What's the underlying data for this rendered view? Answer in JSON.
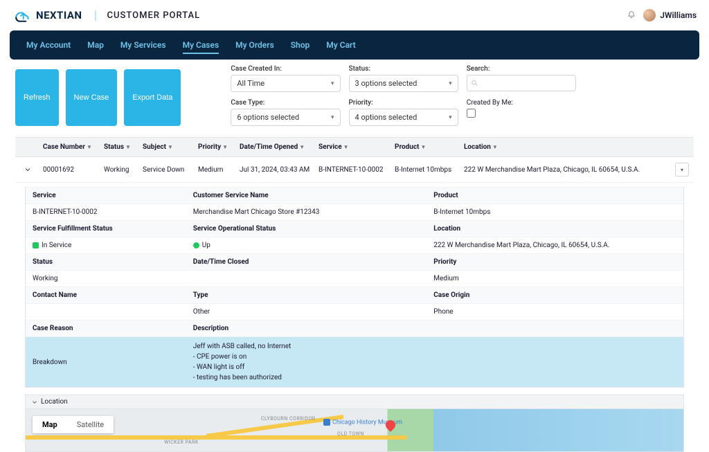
{
  "header": {
    "brand": "NEXTIAN",
    "portal": "CUSTOMER PORTAL",
    "username": "JWilliams"
  },
  "nav": {
    "items": [
      "My Account",
      "Map",
      "My Services",
      "My Cases",
      "My Orders",
      "Shop",
      "My Cart"
    ],
    "active_index": 3
  },
  "actions": {
    "refresh": "Refresh",
    "new_case": "New Case",
    "export_data": "Export Data"
  },
  "filters": {
    "created": {
      "label": "Case Created In:",
      "value": "All Time"
    },
    "status": {
      "label": "Status:",
      "value": "3 options selected"
    },
    "search": {
      "label": "Search:",
      "placeholder": ""
    },
    "type": {
      "label": "Case Type:",
      "value": "6 options selected"
    },
    "priority": {
      "label": "Priority:",
      "value": "4 options selected"
    },
    "created_by_me": {
      "label": "Created By Me:"
    }
  },
  "table": {
    "columns": [
      "Case Number",
      "Status",
      "Subject",
      "Priority",
      "Date/Time Opened",
      "Service",
      "Product",
      "Location"
    ],
    "row": {
      "case_number": "00001692",
      "status": "Working",
      "subject": "Service Down",
      "priority": "Medium",
      "opened": "Jul 31, 2024, 03:43 AM",
      "service": "B-INTERNET-10-0002",
      "product": "B-Internet 10mbps",
      "location": "222 W Merchandise Mart Plaza, Chicago, IL 60654, U.S.A."
    }
  },
  "detail": {
    "service_h": "Service",
    "csn_h": "Customer Service Name",
    "product_h": "Product",
    "service_v": "B-INTERNET-10-0002",
    "csn_v": "Merchandise Mart Chicago Store #12343",
    "product_v": "B-Internet 10mbps",
    "sfs_h": "Service Fulfillment Status",
    "sos_h": "Service Operational Status",
    "loc_h": "Location",
    "sfs_v": "In Service",
    "sos_v": "Up",
    "loc_v": "222 W Merchandise Mart Plaza, Chicago, IL 60654, U.S.A.",
    "status_h": "Status",
    "closed_h": "Date/Time Closed",
    "priority_h": "Priority",
    "status_v": "Working",
    "closed_v": "",
    "priority_v": "Medium",
    "contact_h": "Contact Name",
    "type_h": "Type",
    "origin_h": "Case Origin",
    "contact_v": "",
    "type_v": "Other",
    "origin_v": "Phone",
    "reason_h": "Case Reason",
    "desc_h": "Description",
    "reason_v": "Breakdown",
    "desc_lines": [
      "Jeff with ASB called, no Internet",
      "",
      "- CPE power is on",
      "- WAN light is off",
      "- testing has been authorized"
    ]
  },
  "map_section": {
    "title": "Location",
    "tabs": {
      "map": "Map",
      "sat": "Satellite"
    },
    "labels": {
      "wicker": "WICKER PARK",
      "clybourn": "CLYBOURN CORRIDOR",
      "oldtown": "OLD TOWN",
      "poi": "Chicago History Museum"
    }
  }
}
